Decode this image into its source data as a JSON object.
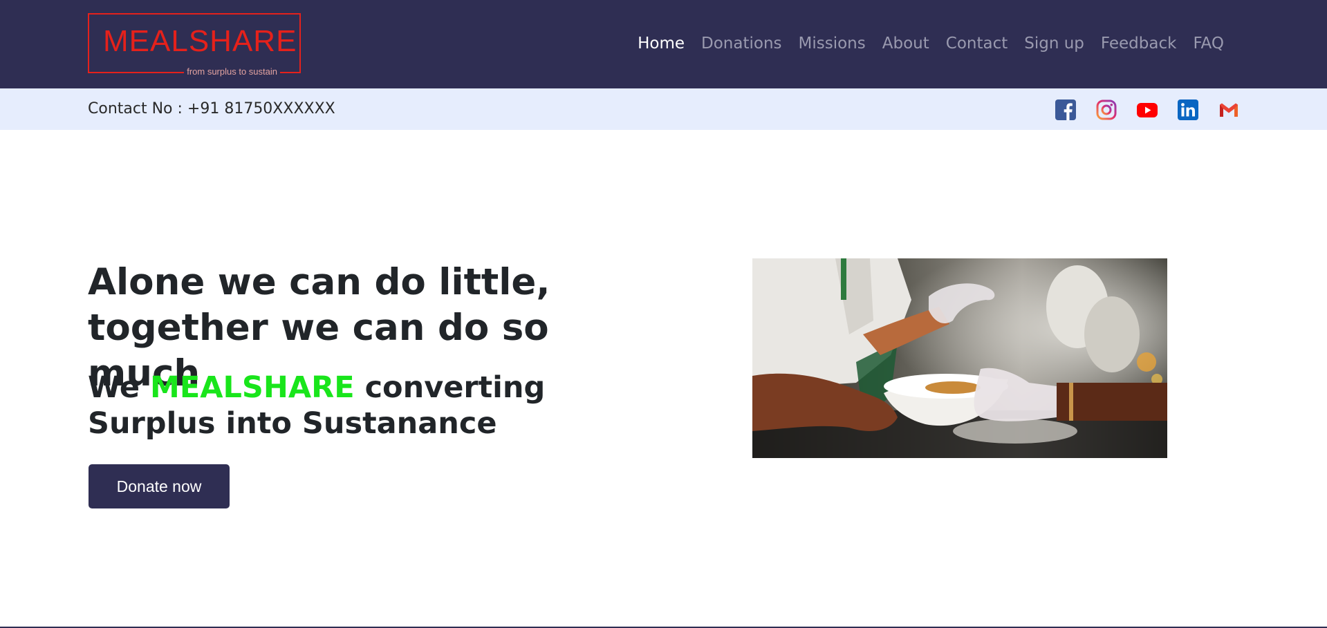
{
  "brand": {
    "name": "MEALSHARE",
    "tagline": "from surplus to sustain",
    "logo_color": "#e5211b"
  },
  "nav": {
    "items": [
      {
        "label": "Home",
        "active": true
      },
      {
        "label": "Donations",
        "active": false
      },
      {
        "label": "Missions",
        "active": false
      },
      {
        "label": "About",
        "active": false
      },
      {
        "label": "Contact",
        "active": false
      },
      {
        "label": "Sign up",
        "active": false
      },
      {
        "label": "Feedback",
        "active": false
      },
      {
        "label": "FAQ",
        "active": false
      }
    ]
  },
  "contact": {
    "label": "Contact No : +91 81750XXXXXX"
  },
  "socials": [
    {
      "icon": "facebook-icon",
      "color": "#3b5998"
    },
    {
      "icon": "instagram-icon",
      "color": "#c13584"
    },
    {
      "icon": "youtube-icon",
      "color": "#ff0000"
    },
    {
      "icon": "linkedin-icon",
      "color": "#0a66c2"
    },
    {
      "icon": "gmail-icon",
      "color": "#ea4335"
    }
  ],
  "hero": {
    "title": "Alone we can do little, together we can do so much",
    "sub_prefix": "We ",
    "sub_brand": "MEALSHARE",
    "sub_suffix": " converting Surplus into Sustanance",
    "button": "Donate now"
  },
  "colors": {
    "navbar": "#2f2e53",
    "contact_bar": "#e6edfd",
    "accent_green": "#19e51b"
  }
}
